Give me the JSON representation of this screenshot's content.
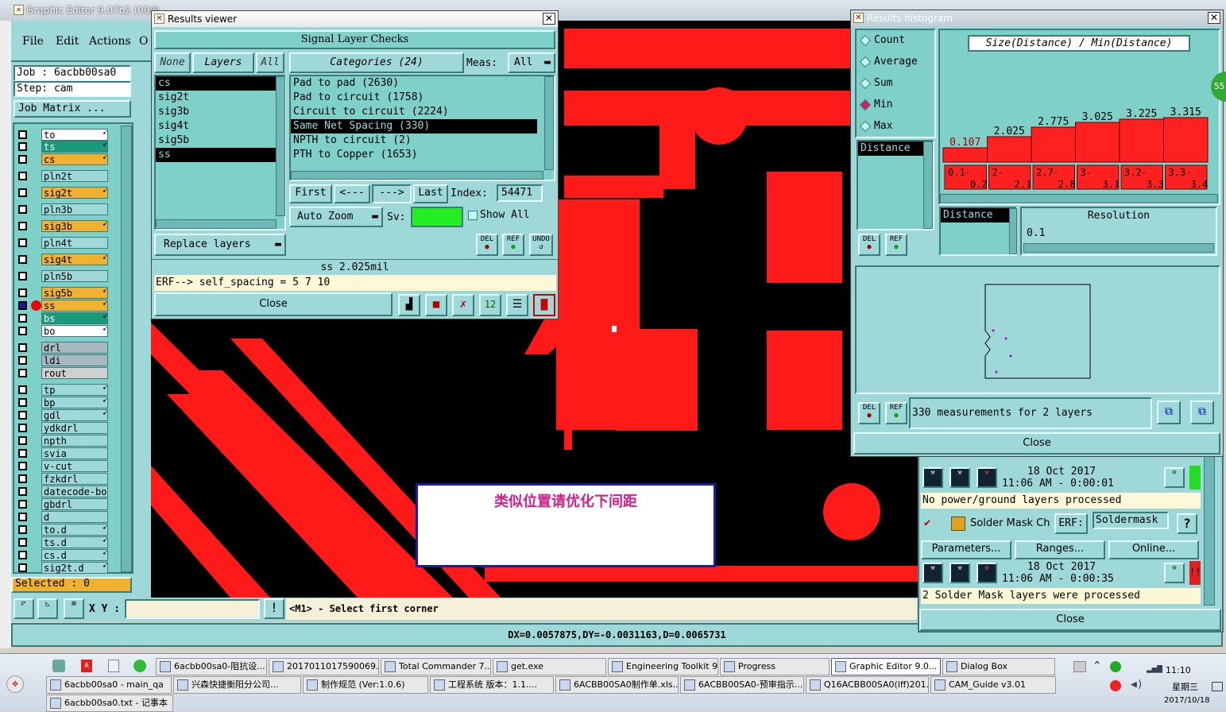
{
  "main_title": "Graphic Editor 9.07b2 (00@",
  "menu": {
    "file": "File",
    "edit": "Edit",
    "actions": "Actions",
    "o": "O"
  },
  "job": {
    "job": "Job  : 6acbb00sa0",
    "step": "Step: cam",
    "matrix": "Job Matrix ..."
  },
  "layers": [
    {
      "name": "to",
      "color": "#ffffff"
    },
    {
      "name": "ts",
      "color": "#1a9a78"
    },
    {
      "name": "cs",
      "color": "#f0b030"
    },
    {
      "name": "pln2t",
      "color": "#9ed8d8"
    },
    {
      "name": "sig2t",
      "color": "#f0b030"
    },
    {
      "name": "pln3b",
      "color": "#9ed8d8"
    },
    {
      "name": "sig3b",
      "color": "#f0b030"
    },
    {
      "name": "pln4t",
      "color": "#9ed8d8"
    },
    {
      "name": "sig4t",
      "color": "#f0b030"
    },
    {
      "name": "pln5b",
      "color": "#9ed8d8"
    },
    {
      "name": "sig5b",
      "color": "#f0b030"
    },
    {
      "name": "ss",
      "color": "#f0b030"
    },
    {
      "name": "bs",
      "color": "#1a9a78"
    },
    {
      "name": "bo",
      "color": "#ffffff"
    },
    {
      "name": "drl",
      "color": "#a8b8c0"
    },
    {
      "name": "ldi",
      "color": "#a8b8c0"
    },
    {
      "name": "rout",
      "color": "#d0d0d0"
    },
    {
      "name": "tp",
      "color": "#9ed8d8"
    },
    {
      "name": "bp",
      "color": "#9ed8d8"
    },
    {
      "name": "gdl",
      "color": "#9ed8d8"
    },
    {
      "name": "ydkdrl",
      "color": "#9ed8d8"
    },
    {
      "name": "npth",
      "color": "#9ed8d8"
    },
    {
      "name": "svia",
      "color": "#9ed8d8"
    },
    {
      "name": "v-cut",
      "color": "#9ed8d8"
    },
    {
      "name": "fzkdrl",
      "color": "#9ed8d8"
    },
    {
      "name": "datecode-bo",
      "color": "#9ed8d8"
    },
    {
      "name": "gbdrl",
      "color": "#9ed8d8"
    },
    {
      "name": "d",
      "color": "#9ed8d8"
    },
    {
      "name": "to.d",
      "color": "#9ed8d8"
    },
    {
      "name": "ts.d",
      "color": "#9ed8d8"
    },
    {
      "name": "cs.d",
      "color": "#9ed8d8"
    },
    {
      "name": "sig2t.d",
      "color": "#9ed8d8"
    }
  ],
  "selected": "Selected : 0",
  "xy_label": "X Y :",
  "prompt": "<M1> - Select first corner",
  "status": "DX=0.0057875,DY=-0.0031163,D=0.0065731",
  "results_viewer": {
    "title": "Results viewer",
    "header": "Signal Layer Checks",
    "none": "None",
    "layers": "Layers",
    "all": "All",
    "categories_label": "Categories (24)",
    "meas_label": "Meas:",
    "meas_value": "All",
    "layer_list": [
      "cs",
      "sig2t",
      "sig3b",
      "sig4t",
      "sig5b",
      "ss"
    ],
    "categories": [
      "Pad to pad (2630)",
      "Pad to circuit (1758)",
      "Circuit to circuit (2224)",
      "Same Net Spacing (330)",
      "NPTH to circuit (2)",
      "PTH to Copper (1653)"
    ],
    "first": "First",
    "prev": "<---",
    "next": "--->",
    "last": "Last",
    "index_label": "Index:",
    "index_value": "54471",
    "auto_zoom": "Auto Zoom",
    "sv": "Sv:",
    "show_all": "Show All",
    "replace_layers": "Replace layers",
    "del": "DEL",
    "ref": "REF",
    "undo": "UNDO",
    "value": "ss 2.025mil",
    "erf": "ERF--> self_spacing = 5 7 10",
    "close": "Close"
  },
  "histogram": {
    "title": "Results histogram",
    "options": [
      "Count",
      "Average",
      "Sum",
      "Min",
      "Max"
    ],
    "selected_option": "Min",
    "chart_title": "Size(Distance) / Min(Distance)",
    "distance": "Distance",
    "distance2": "Distance",
    "resolution_label": "Resolution",
    "resolution_value": "0.1",
    "summary": "330 measurements for 2 layers",
    "close": "Close",
    "del": "DEL",
    "ref": "REF"
  },
  "chart_data": {
    "type": "bar",
    "title": "Size(Distance) / Min(Distance)",
    "categories": [
      "0.1-0.2",
      "2-2.1",
      "2.7-2.8",
      "3-3.1",
      "3.2-3.3",
      "3.3-3.4"
    ],
    "values": [
      0.107,
      2.025,
      2.775,
      3.025,
      3.225,
      3.315
    ],
    "value_labels": [
      "0.107",
      "2.025",
      "2.775",
      "3.025",
      "3.225",
      "3.315"
    ],
    "ylim": [
      0,
      3.4
    ],
    "color": "#ff2020"
  },
  "annotation": "类似位置请优化下间距",
  "bottom_right": {
    "date1": "18 Oct 2017",
    "time1": "11:06 AM - 0:00:01",
    "msg1": "No power/ground layers processed",
    "check_name": "Solder Mask Ch",
    "erf": "ERF:",
    "erf_value": "Soldermask",
    "help": "?",
    "params": "Parameters...",
    "ranges": "Ranges...",
    "online": "Online...",
    "date2": "18 Oct 2017",
    "time2": "11:06 AM - 0:00:35",
    "msg2": "2 Solder Mask layers were processed",
    "close": "Close"
  },
  "taskbar": {
    "row1": [
      "6acbb00sa0-阻抗设...",
      "2017011017590069...",
      "Total Commander 7....",
      "get.exe",
      "Engineering Toolkit 9...",
      "Progress",
      "Graphic Editor 9.0...",
      "Dialog Box"
    ],
    "row2": [
      "6acbb00sa0 - main_qa",
      "兴森快捷衡阳分公司...",
      "制作规范 (Ver:1.0.6)",
      "工程系统  版本：1.1....",
      "6ACBB00SA0制作单.xls...",
      "6ACBB00SA0-预审指示...",
      "Q16ACBB00SA0(lff)201...",
      "CAM_Guide v3.01"
    ],
    "row3": [
      "6acbb00sa0.txt - 记事本"
    ],
    "clock": "11:10",
    "weekday": "星期三",
    "date": "2017/10/18",
    "badge": "55"
  }
}
